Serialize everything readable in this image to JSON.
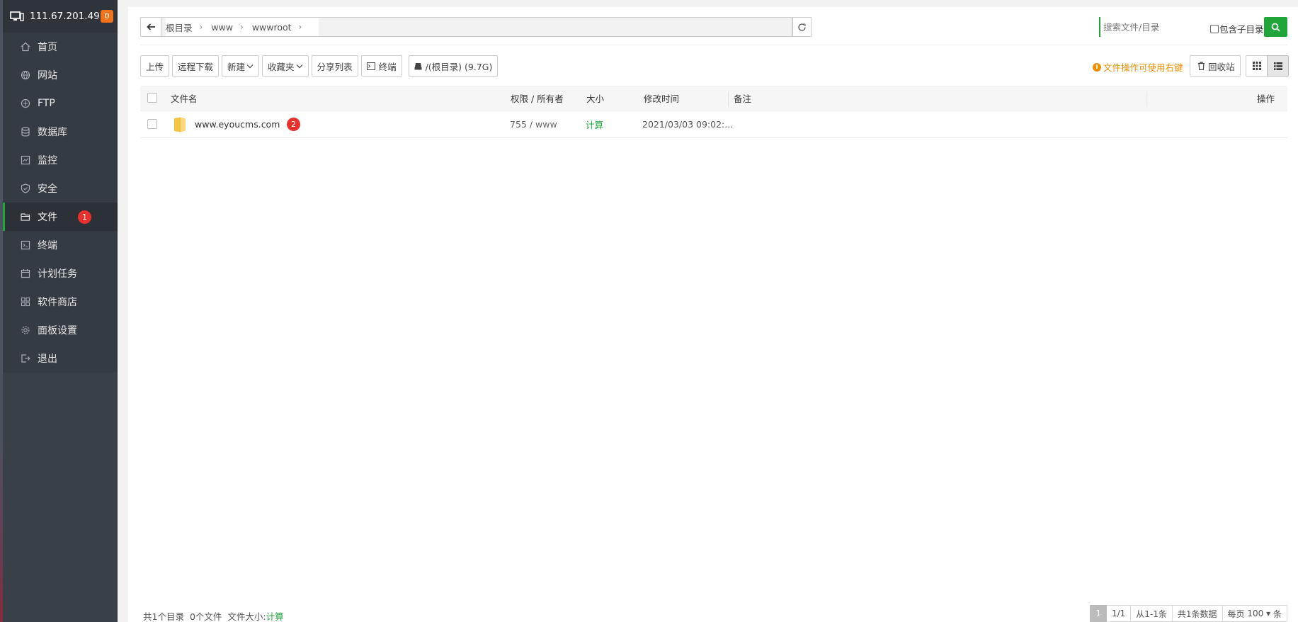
{
  "sidebar": {
    "server_ip": "111.67.201.49",
    "alert_count": "0",
    "items": [
      {
        "label": "首页",
        "icon": "home-icon"
      },
      {
        "label": "网站",
        "icon": "globe-icon"
      },
      {
        "label": "FTP",
        "icon": "ftp-icon"
      },
      {
        "label": "数据库",
        "icon": "database-icon"
      },
      {
        "label": "监控",
        "icon": "monitor-icon"
      },
      {
        "label": "安全",
        "icon": "shield-icon"
      },
      {
        "label": "文件",
        "icon": "folder-icon",
        "active": true,
        "badge": "1"
      },
      {
        "label": "终端",
        "icon": "terminal-icon"
      },
      {
        "label": "计划任务",
        "icon": "calendar-icon"
      },
      {
        "label": "软件商店",
        "icon": "apps-icon"
      },
      {
        "label": "面板设置",
        "icon": "gear-icon"
      },
      {
        "label": "退出",
        "icon": "logout-icon"
      }
    ]
  },
  "path": {
    "crumbs": [
      "根目录",
      "www",
      "wwwroot"
    ]
  },
  "search": {
    "placeholder": "搜索文件/目录",
    "include_sub_label": "包含子目录"
  },
  "toolbar": {
    "upload": "上传",
    "remote_download": "远程下载",
    "new": "新建",
    "favorites": "收藏夹",
    "share_list": "分享列表",
    "terminal": "终端",
    "disk": "/(根目录) (9.7G)",
    "tip": "文件操作可使用右键",
    "recycle": "回收站"
  },
  "table": {
    "headers": {
      "name": "文件名",
      "perm_owner": "权限 / 所有者",
      "size": "大小",
      "mtime": "修改时间",
      "remark": "备注",
      "actions": "操作"
    },
    "rows": [
      {
        "name": "www.eyoucms.com",
        "badge": "2",
        "perm_owner": "755 / www",
        "size": "计算",
        "mtime": "2021/03/03 09:02:...",
        "remark": ""
      }
    ]
  },
  "footer": {
    "dirs": "共1个目录",
    "files": "0个文件",
    "size_label": "文件大小:",
    "size_value": "计算",
    "pager": {
      "current": "1",
      "pages": "1/1",
      "range": "从1-1条",
      "total": "共1条数据",
      "per_page_label": "每页",
      "per_page": "100",
      "unit": "条"
    }
  },
  "colors": {
    "accent": "#20a53a",
    "sidebar_bg": "#3a4048",
    "badge_red": "#e8302d",
    "badge_orange": "#f0731c",
    "tip_orange": "#ef8f00"
  }
}
